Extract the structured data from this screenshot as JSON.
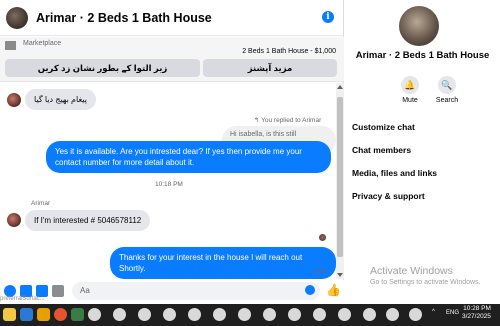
{
  "header": {
    "title": "Arimar · 2 Beds 1 Bath House"
  },
  "listing": {
    "marketplace_label": "Marketplace",
    "price_text": "2 Beds 1 Bath House - $1,000",
    "button_left": "زیر التوا کے بطور نشان زد کریں",
    "button_right": "مزید آپشنز"
  },
  "messages": {
    "first_incoming": "پیغام بھیج دیا گیا",
    "reply_note": "You replied to Arimar",
    "quoted": "Hi isabella, is this still available?",
    "outgoing_1": "Yes it is available. Are you intrested dear? If yes then provide me your contact number for more detail about it.",
    "timestamp": "10:18 PM",
    "sender_name": "Arimar",
    "incoming_2": "If I'm interested # 5046578112",
    "outgoing_2": "Thanks for your interest in the house I will reach out Shortly.",
    "status": "Sent"
  },
  "composer": {
    "placeholder": "Aa",
    "overlay": "preferralSurfac..."
  },
  "sidebar": {
    "name": "Arimar · 2 Beds 1 Bath House",
    "actions": [
      {
        "label": "Mute",
        "icon": "bell-icon"
      },
      {
        "label": "Search",
        "icon": "search-icon"
      }
    ],
    "menu": [
      "Customize chat",
      "Chat members",
      "Media, files and links",
      "Privacy & support"
    ]
  },
  "watermark": {
    "line1": "Activate Windows",
    "line2": "Go to Settings to activate Windows."
  },
  "taskbar": {
    "lang": "ENG",
    "time": "10:28 PM",
    "date": "3/27/2025"
  },
  "colors": {
    "accent": "#0a7cff",
    "taskbar": "#1f1f1f"
  }
}
